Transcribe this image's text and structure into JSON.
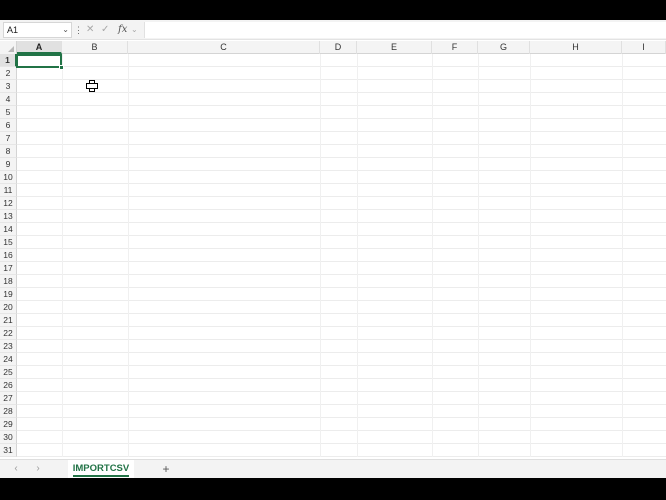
{
  "formula_bar": {
    "name_box": "A1",
    "name_box_arrow": "⌄",
    "dots": "⋮",
    "cancel_icon": "✕",
    "enter_icon": "✓",
    "fx_label": "fx",
    "fx_arrow": "⌄",
    "formula_value": ""
  },
  "columns": [
    "A",
    "B",
    "C",
    "D",
    "E",
    "F",
    "G",
    "H",
    "I"
  ],
  "active_column": "A",
  "rows": [
    "1",
    "2",
    "3",
    "4",
    "5",
    "6",
    "7",
    "8",
    "9",
    "10",
    "11",
    "12",
    "13",
    "14",
    "15",
    "16",
    "17",
    "18",
    "19",
    "20",
    "21",
    "22",
    "23",
    "24",
    "25",
    "26",
    "27",
    "28",
    "29",
    "30",
    "31"
  ],
  "active_row": "1",
  "active_cell": "A1",
  "sheet_tabs": {
    "prev_icon": "‹",
    "next_icon": "›",
    "tabs": [
      {
        "label": "IMPORTCSV",
        "active": true
      }
    ],
    "add_icon": "+"
  },
  "colors": {
    "accent": "#217346",
    "header_bg": "#f4f4f4",
    "gridline": "#ececec"
  }
}
